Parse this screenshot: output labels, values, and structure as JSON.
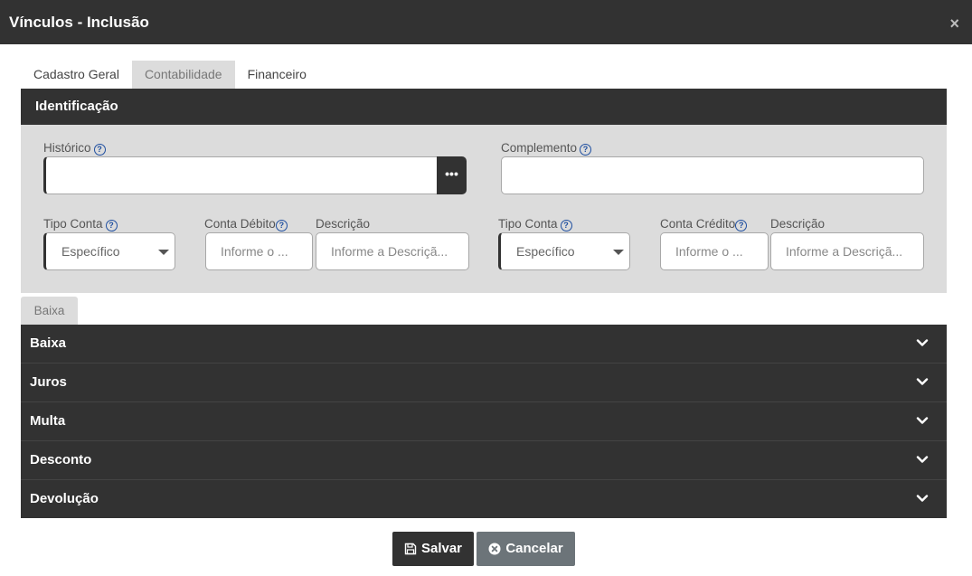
{
  "window": {
    "title": "Vínculos - Inclusão",
    "close_glyph": "×"
  },
  "tabs": [
    {
      "label": "Cadastro Geral"
    },
    {
      "label": "Contabilidade"
    },
    {
      "label": "Financeiro"
    }
  ],
  "active_tab": "Contabilidade",
  "identificacao": {
    "heading": "Identificação",
    "historico": {
      "label": "Histórico",
      "value": "",
      "button_label": "•••"
    },
    "complemento": {
      "label": "Complemento",
      "value": ""
    },
    "debito": {
      "tipo_label": "Tipo Conta",
      "tipo_value": "Específico",
      "conta_label": "Conta Débito",
      "conta_placeholder": "Informe o ...",
      "descricao_label": "Descrição",
      "descricao_placeholder": "Informe a Descriçã..."
    },
    "credito": {
      "tipo_label": "Tipo Conta",
      "tipo_value": "Específico",
      "conta_label": "Conta Crédito",
      "conta_placeholder": "Informe o ...",
      "descricao_label": "Descrição",
      "descricao_placeholder": "Informe a Descriçã..."
    },
    "help_glyph": "?"
  },
  "subtab": {
    "label": "Baixa"
  },
  "accordion": [
    {
      "label": "Baixa"
    },
    {
      "label": "Juros"
    },
    {
      "label": "Multa"
    },
    {
      "label": "Desconto"
    },
    {
      "label": "Devolução"
    }
  ],
  "footer": {
    "save_label": "Salvar",
    "cancel_label": "Cancelar"
  },
  "icons": {
    "save": "floppy-disk-icon",
    "cancel": "x-circle-icon",
    "chevron": "chevron-down-icon",
    "help": "question-circle-icon"
  }
}
